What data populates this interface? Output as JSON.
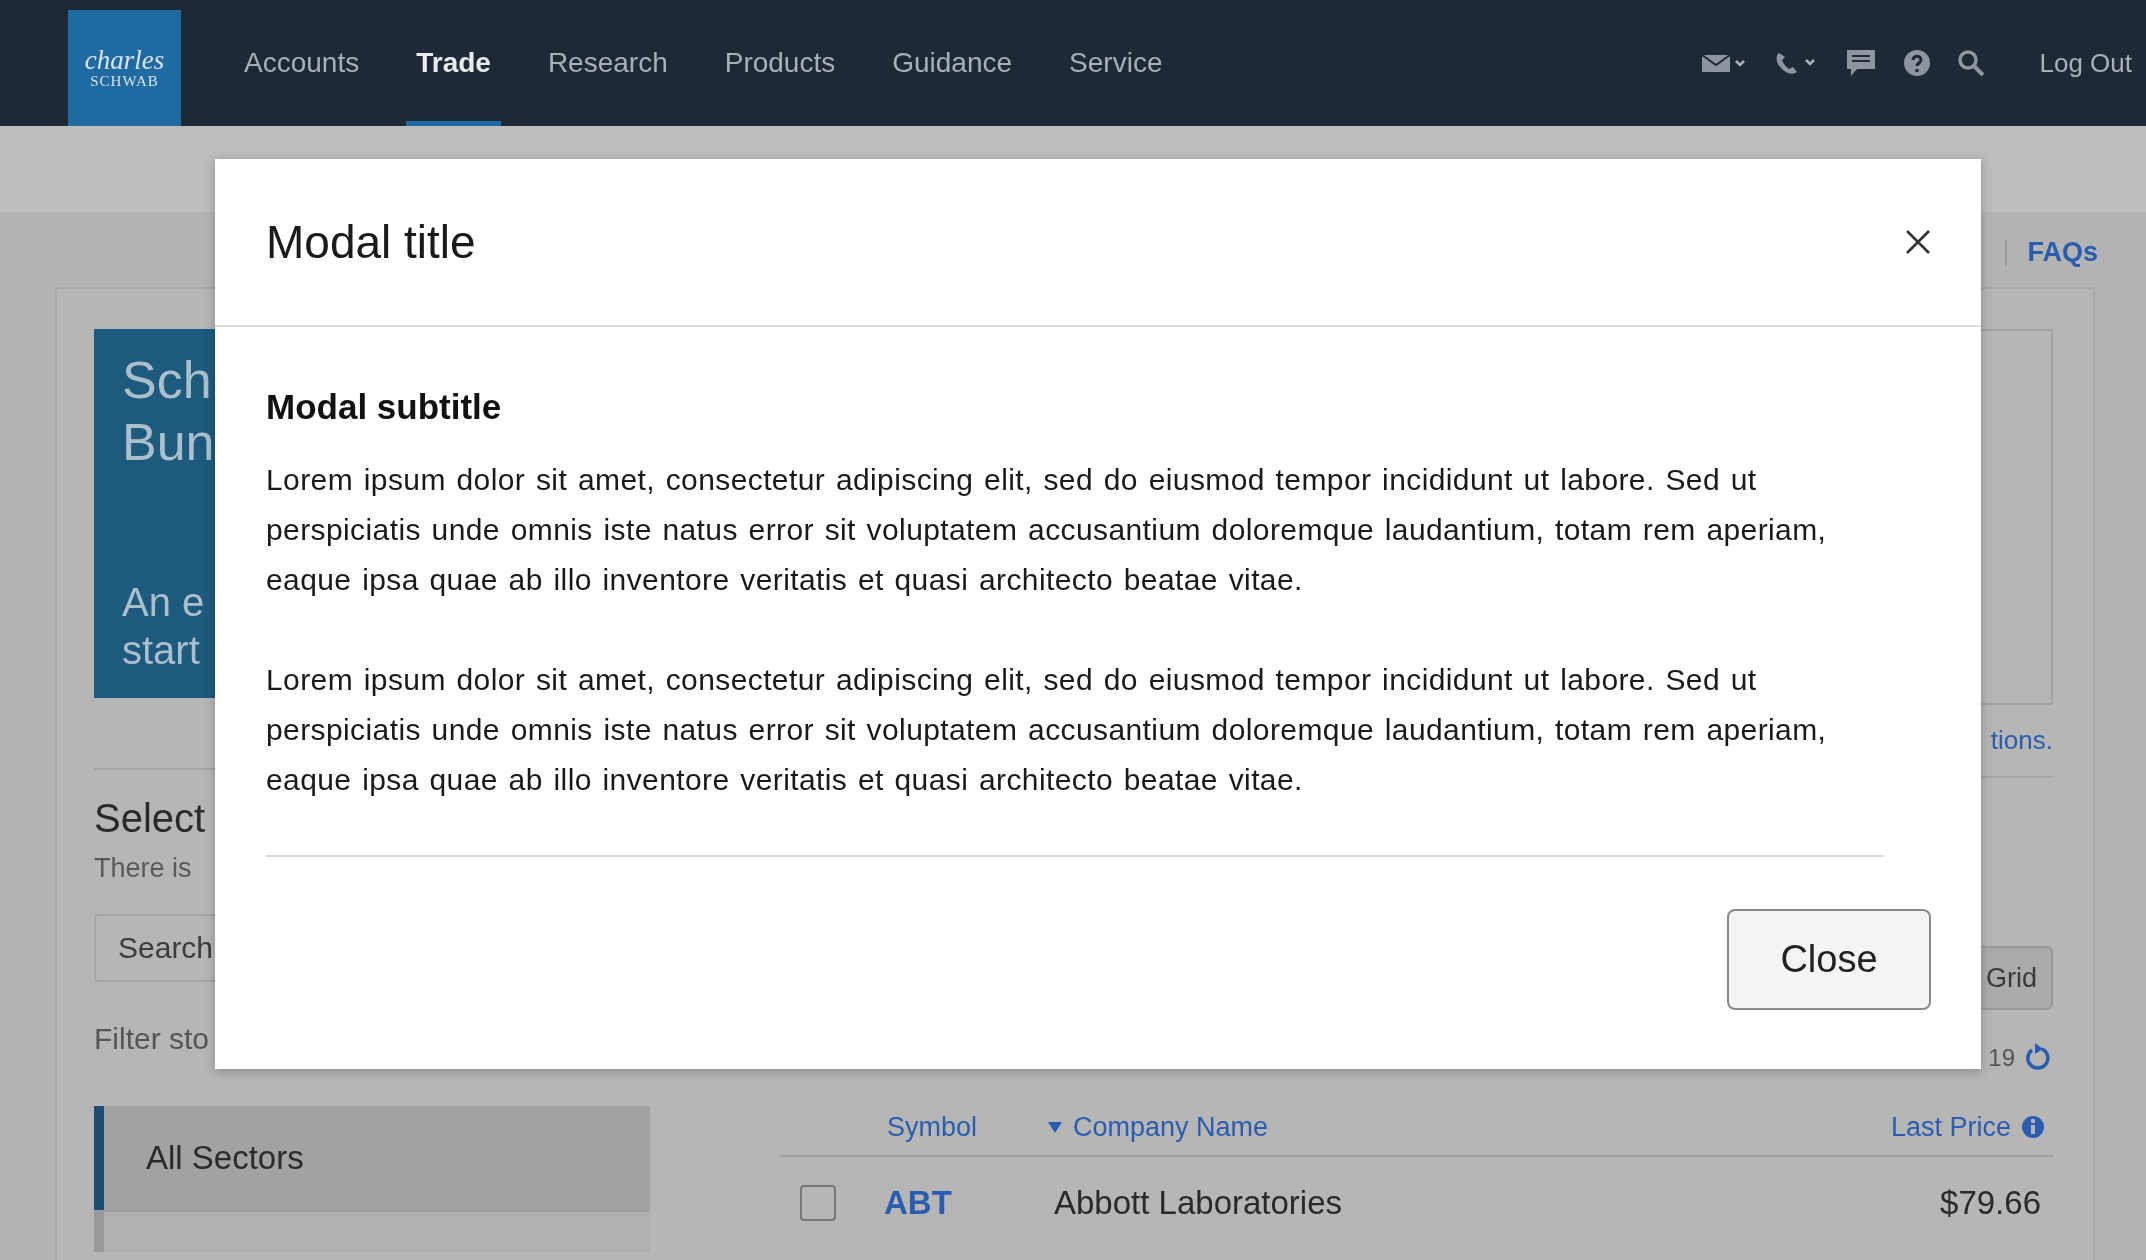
{
  "nav": {
    "logo": [
      "charles",
      "SCHWAB"
    ],
    "items": [
      {
        "label": "Accounts",
        "selected": false
      },
      {
        "label": "Trade",
        "selected": true
      },
      {
        "label": "Research",
        "selected": false
      },
      {
        "label": "Products",
        "selected": false
      },
      {
        "label": "Guidance",
        "selected": false
      },
      {
        "label": "Service",
        "selected": false
      }
    ],
    "log_out": "Log Out"
  },
  "page": {
    "faqs": "FAQs",
    "banner": {
      "title": [
        "Sch",
        "Bun"
      ],
      "text": [
        "An e",
        "start"
      ]
    },
    "section_title": "Select",
    "section_text": "There is",
    "search": {
      "placeholder": "Search"
    },
    "filter_label": "Filter sto",
    "sectors": [
      {
        "label": "All Sectors",
        "selected": true
      }
    ],
    "link": "tions.",
    "grid_button": "Grid",
    "updated": "19",
    "table": {
      "columns": [
        {
          "label": "Symbol",
          "sorted": false,
          "info": false
        },
        {
          "label": "Company Name",
          "sorted": true,
          "info": false
        },
        {
          "label": "Last Price",
          "sorted": false,
          "info": true
        }
      ],
      "rows": [
        {
          "symbol": "ABT",
          "company": "Abbott Laboratories",
          "last_price": "$79.66",
          "checked": false
        }
      ]
    }
  },
  "modal": {
    "title": "Modal title",
    "subtitle": "Modal subtitle",
    "paragraphs": [
      "Lorem ipsum dolor sit amet, consectetur adipiscing elit, sed do eiusmod tempor incididunt ut labore. Sed ut perspiciatis unde omnis iste natus error sit voluptatem accusantium doloremque laudantium, totam rem aperiam, eaque ipsa quae ab illo inventore veritatis et quasi architecto beatae vitae.",
      "Lorem ipsum dolor sit amet, consectetur adipiscing elit, sed do eiusmod tempor incididunt ut labore. Sed ut perspiciatis unde omnis iste natus error sit voluptatem accusantium doloremque laudantium, totam rem aperiam, eaque ipsa quae ab illo inventore veritatis et quasi architecto beatae vitae."
    ],
    "button": "Close"
  }
}
